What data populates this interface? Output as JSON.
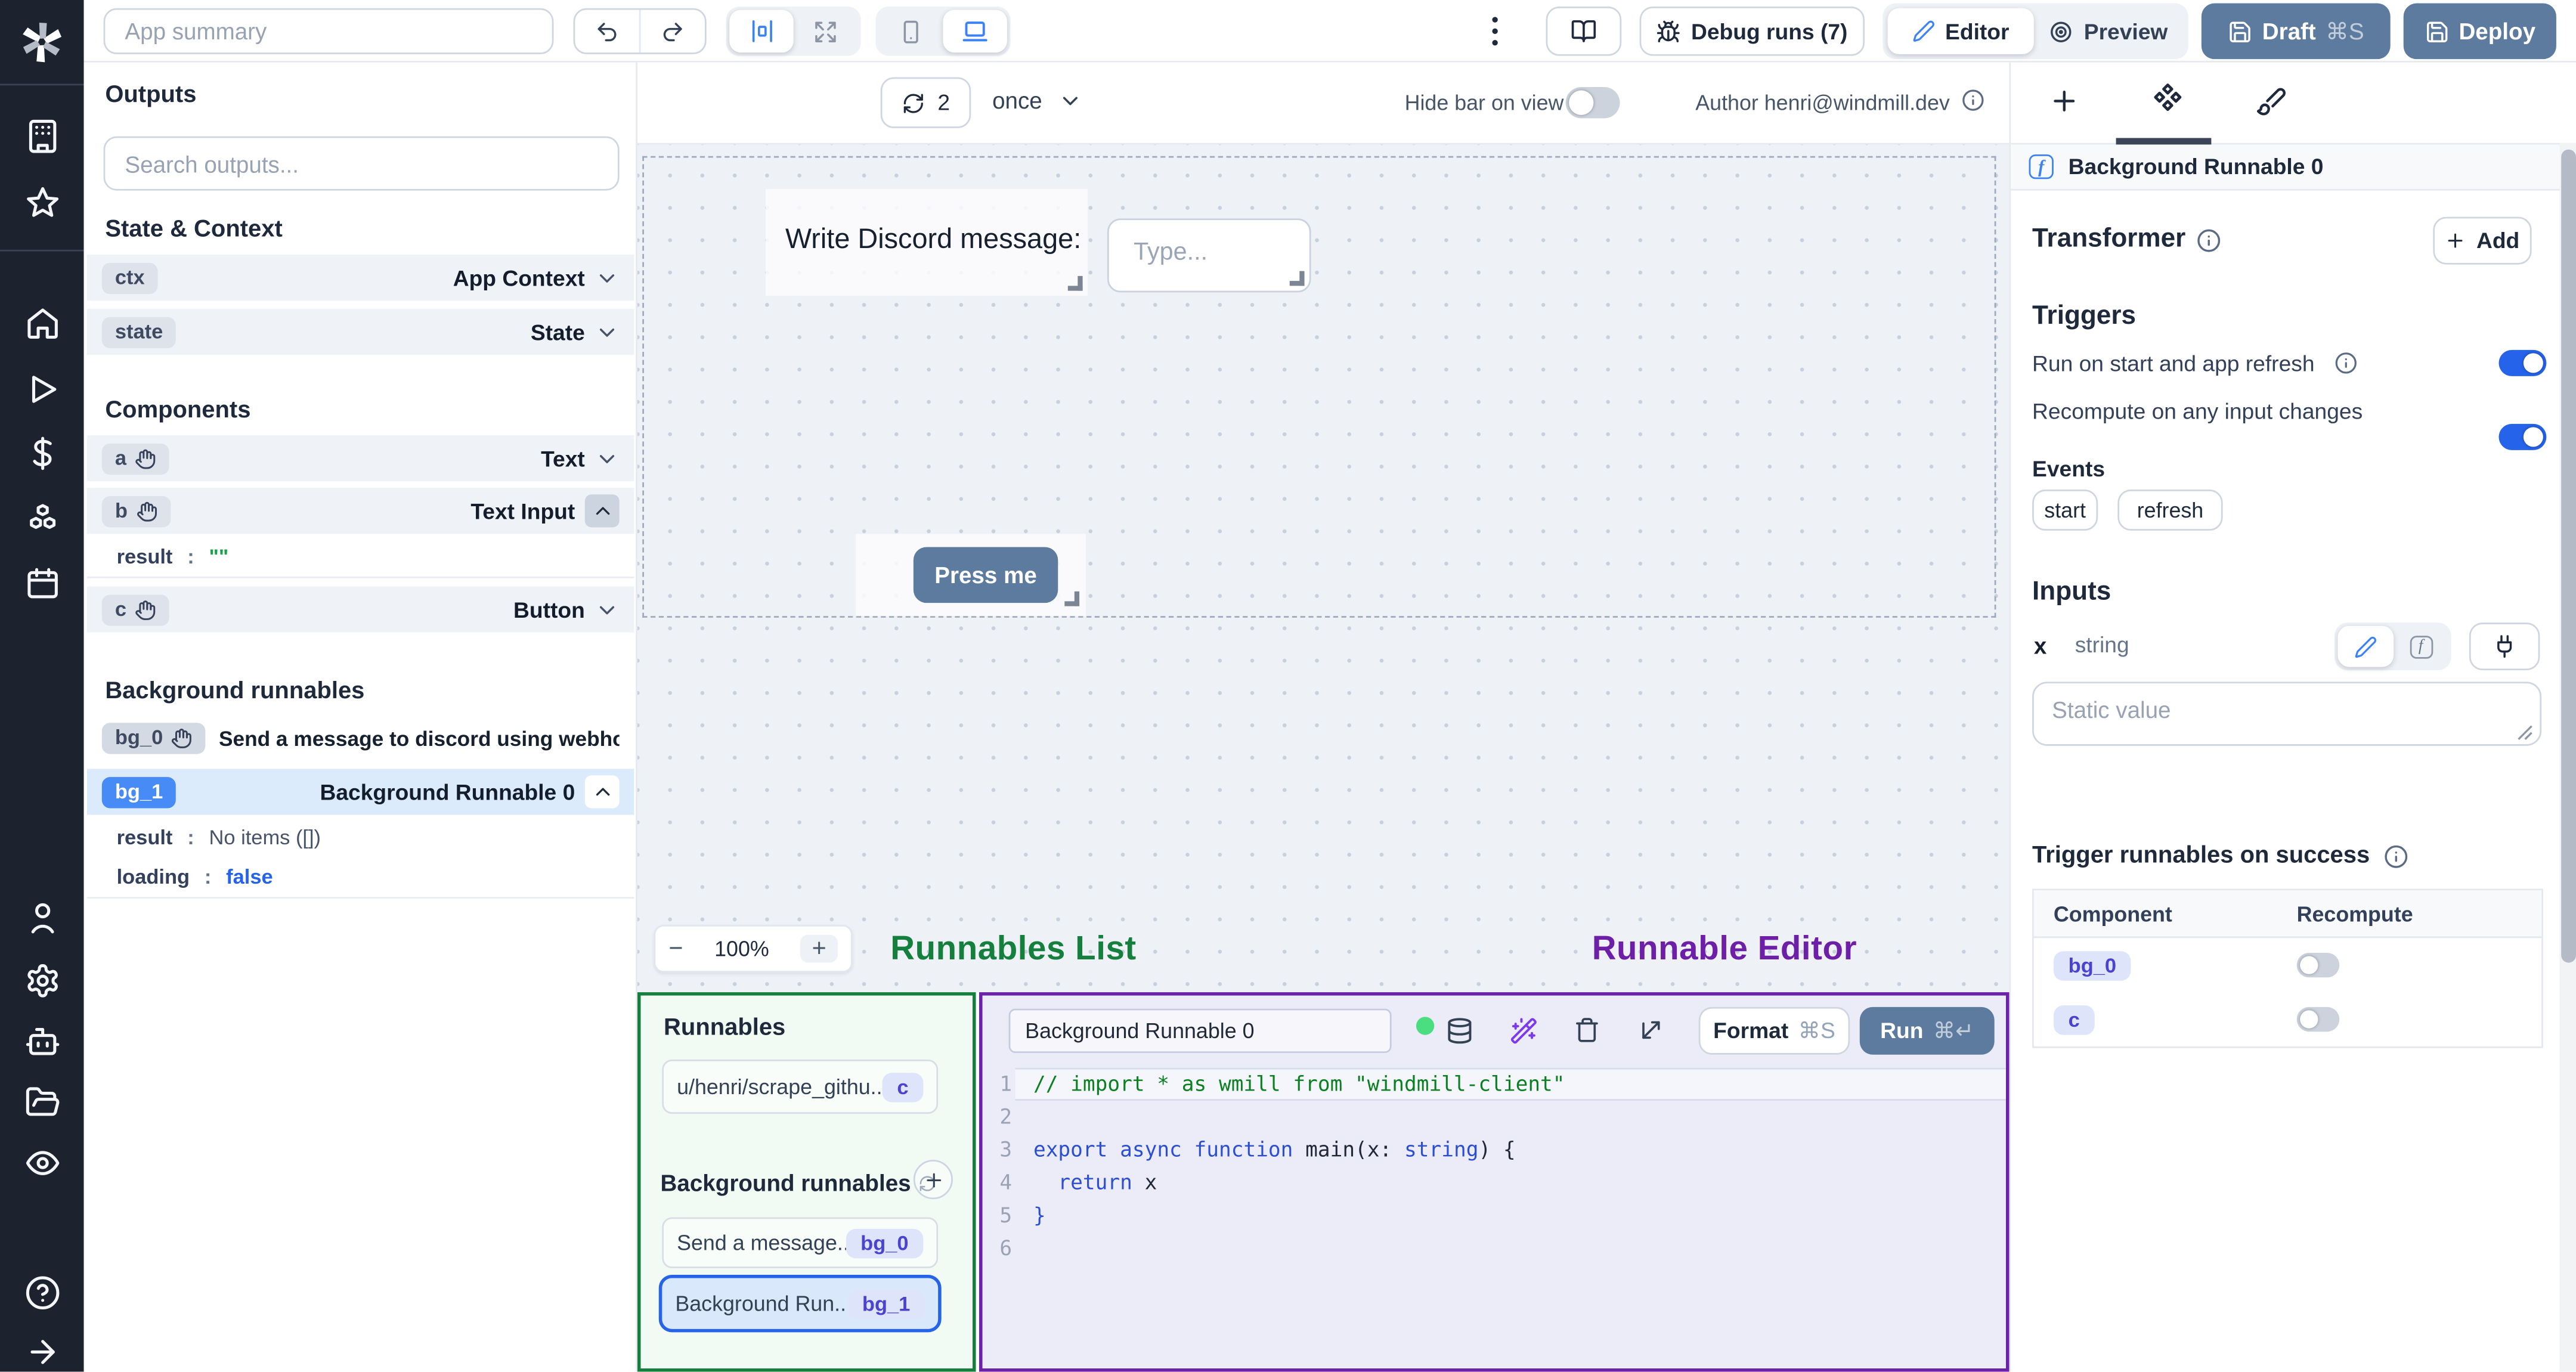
{
  "topbar": {
    "app_summary_placeholder": "App summary",
    "debug_runs": "Debug runs (7)",
    "editor": "Editor",
    "preview": "Preview",
    "draft": "Draft",
    "draft_shortcut": "⌘S",
    "deploy": "Deploy"
  },
  "outputs": {
    "title": "Outputs",
    "search_placeholder": "Search outputs...",
    "state_context_title": "State & Context",
    "state_rows": [
      {
        "badge": "ctx",
        "label": "App Context"
      },
      {
        "badge": "state",
        "label": "State"
      }
    ],
    "components_title": "Components",
    "component_rows": [
      {
        "badge": "a",
        "label": "Text"
      },
      {
        "badge": "b",
        "label": "Text Input"
      },
      {
        "badge": "c",
        "label": "Button"
      }
    ],
    "b_detail": {
      "key": "result",
      "colon": ":",
      "value": "\"\""
    },
    "background_title": "Background runnables",
    "bg0": {
      "badge": "bg_0",
      "label": "Send a message to discord using webhoo"
    },
    "bg1": {
      "badge": "bg_1",
      "label": "Background Runnable 0"
    },
    "bg1_detail1": {
      "key": "result",
      "colon": ":",
      "value": "No items ([])"
    },
    "bg1_detail2": {
      "key": "loading",
      "colon": ":",
      "value": "false"
    }
  },
  "canvasbar": {
    "refresh_count": "2",
    "mode": "once",
    "hide_bar_label": "Hide bar on view",
    "author": "Author henri@windmill.dev"
  },
  "canvas": {
    "text_component": "Write Discord message:",
    "input_placeholder": "Type...",
    "button_label": "Press me",
    "zoom_out": "−",
    "zoom_level": "100%",
    "zoom_in": "+",
    "runnables_list_label": "Runnables List",
    "runnable_editor_label": "Runnable Editor"
  },
  "runnables": {
    "title": "Runnables",
    "item1": {
      "label": "u/henri/scrape_githu...",
      "badge": "c"
    },
    "background_title": "Background runnables",
    "item2": {
      "label": "Send a message...",
      "badge": "bg_0"
    },
    "item3": {
      "label": "Background Run...",
      "badge": "bg_1"
    }
  },
  "editor": {
    "name": "Background Runnable 0",
    "format": "Format",
    "format_shortcut": "⌘S",
    "run": "Run",
    "run_shortcut": "⌘↵",
    "line_numbers": [
      "1",
      "2",
      "3",
      "4",
      "5",
      "6"
    ],
    "code": {
      "comment": "// import * as wmill from \"windmill-client\"",
      "kw_export": "export ",
      "kw_async": "async ",
      "kw_function": "function ",
      "fn_open": "main(x: ",
      "type_string": "string",
      "fn_close": ") {",
      "kw_return": "  return ",
      "return_val": "x",
      "brace_close": "}"
    }
  },
  "panel": {
    "header": "Background Runnable 0",
    "fx_glyph": "f",
    "transformer_title": "Transformer",
    "add": "Add",
    "triggers_title": "Triggers",
    "trigger1": "Run on start and app refresh",
    "trigger2": "Recompute on any input changes",
    "events_title": "Events",
    "event1": "start",
    "event2": "refresh",
    "inputs_title": "Inputs",
    "input_name": "x",
    "input_type": "string",
    "static_placeholder": "Static value",
    "trigger_success_title": "Trigger runnables on success",
    "col_component": "Component",
    "col_recompute": "Recompute",
    "row1_badge": "bg_0",
    "row2_badge": "c"
  },
  "colors": {
    "accent_blue": "#2563eb",
    "brand_slate_blue": "#5d7b9e",
    "runnables_green": "#15803d",
    "editor_purple": "#6b21a8"
  }
}
